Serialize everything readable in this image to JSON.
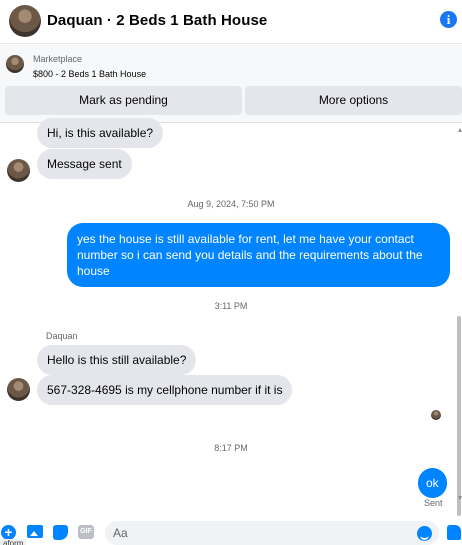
{
  "header": {
    "title": "Daquan · 2 Beds 1 Bath House",
    "info_glyph": "i"
  },
  "marketplace": {
    "label": "Marketplace",
    "item": "$800 - 2 Beds 1 Bath House",
    "mark_pending": "Mark as pending",
    "more_options": "More options"
  },
  "messages": {
    "m1": "Hi, is this available?",
    "m2": "Message sent",
    "ts1": "Aug 9, 2024, 7:50 PM",
    "m3": "yes the house is still available for rent, let me have your contact number so i can send you details and the requirements about the house",
    "ts2": "3:11 PM",
    "sender": "Daquan",
    "m4": "Hello is this still available?",
    "m5": "567-328-4695 is my cellphone number if it is",
    "ts3": "8:17 PM",
    "m6": "ok",
    "status": "Sent"
  },
  "composer": {
    "placeholder": "Aa",
    "plus_glyph": "+",
    "gif_label": "GIF",
    "tooltip": "aform"
  },
  "colors": {
    "accent": "#0084ff",
    "incoming_bubble": "#e4e6eb"
  },
  "icons": [
    "info-icon",
    "plus-icon",
    "photo-icon",
    "sticker-icon",
    "gif-icon",
    "emoji-icon",
    "like-icon"
  ]
}
